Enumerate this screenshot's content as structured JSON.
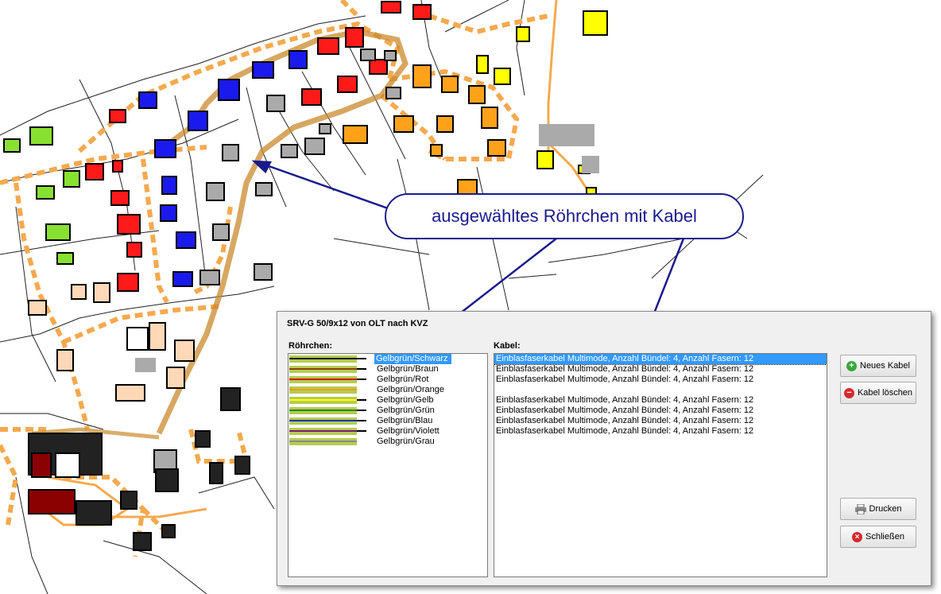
{
  "callout": {
    "text": "ausgewähltes Röhrchen mit Kabel"
  },
  "dialog": {
    "title": "SRV-G 50/9x12 von OLT nach KVZ",
    "tubes_label": "Röhrchen:",
    "cables_label": "Kabel:",
    "tubes": [
      {
        "label": "Gelbgrün/Schwarz",
        "stripe": "#1b1b1b",
        "has_cable": true,
        "selected": true
      },
      {
        "label": "Gelbgrün/Braun",
        "stripe": "#8b4513",
        "has_cable": true,
        "selected": false
      },
      {
        "label": "Gelbgrün/Rot",
        "stripe": "#d11a1a",
        "has_cable": true,
        "selected": false
      },
      {
        "label": "Gelbgrün/Orange",
        "stripe": "#ff9a1a",
        "has_cable": false,
        "selected": false
      },
      {
        "label": "Gelbgrün/Gelb",
        "stripe": "#ffff00",
        "has_cable": true,
        "selected": false
      },
      {
        "label": "Gelbgrün/Grün",
        "stripe": "#1e8a1e",
        "has_cable": true,
        "selected": false
      },
      {
        "label": "Gelbgrün/Blau",
        "stripe": "#1a2ecc",
        "has_cable": true,
        "selected": false
      },
      {
        "label": "Gelbgrün/Violett",
        "stripe": "#7a1a7a",
        "has_cable": true,
        "selected": false
      },
      {
        "label": "Gelbgrün/Grau",
        "stripe": "#8a8a8a",
        "has_cable": false,
        "selected": false
      }
    ],
    "tube_base_color": "#b5cc50",
    "cables": [
      "Einblasfaserkabel Multimode, Anzahl Bündel: 4, Anzahl Fasern: 12",
      "Einblasfaserkabel Multimode, Anzahl Bündel: 4, Anzahl Fasern: 12",
      "Einblasfaserkabel Multimode, Anzahl Bündel: 4, Anzahl Fasern: 12",
      "",
      "Einblasfaserkabel Multimode, Anzahl Bündel: 4, Anzahl Fasern: 12",
      "Einblasfaserkabel Multimode, Anzahl Bündel: 4, Anzahl Fasern: 12",
      "Einblasfaserkabel Multimode, Anzahl Bündel: 4, Anzahl Fasern: 12",
      "Einblasfaserkabel Multimode, Anzahl Bündel: 4, Anzahl Fasern: 12"
    ],
    "buttons": {
      "new_cable": "Neues Kabel",
      "delete_cable": "Kabel löschen",
      "print": "Drucken",
      "close": "Schließen"
    }
  },
  "colors": {
    "route": "#f5a94f",
    "route_selected": "#c98a2e",
    "arrow": "#1a1a8c",
    "selection": "#3399ff"
  }
}
